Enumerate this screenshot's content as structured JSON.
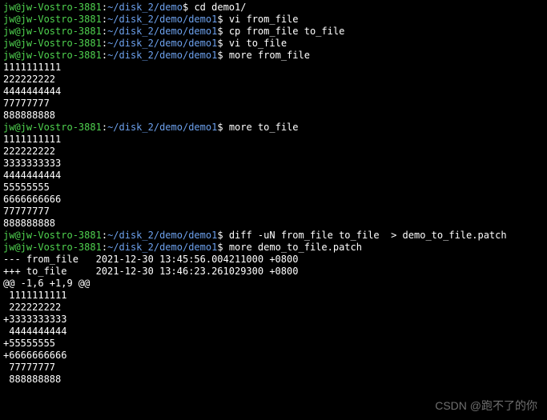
{
  "prompt": {
    "userhost": "jw@jw-Vostro-3881",
    "path_short": "~/disk_2/demo",
    "path_long": "~/disk_2/demo/demo1",
    "sep_colon": ":",
    "dollar": "$"
  },
  "cmds": {
    "cd": "cd demo1/",
    "vi_from": "vi from_file",
    "cp": "cp from_file to_file",
    "vi_to": "vi to_file",
    "more_from": "more from_file",
    "more_to": "more to_file",
    "diff": "diff -uN from_file to_file  > demo_to_file.patch",
    "more_patch": "more demo_to_file.patch"
  },
  "from_file": [
    "1111111111",
    "222222222",
    "4444444444",
    "77777777",
    "888888888"
  ],
  "blank": "",
  "to_file": [
    "1111111111",
    "222222222",
    "3333333333",
    "4444444444",
    "55555555",
    "6666666666",
    "77777777",
    "888888888"
  ],
  "patch": {
    "header_from": "--- from_file   2021-12-30 13:45:56.004211000 +0800",
    "header_to": "+++ to_file     2021-12-30 13:46:23.261029300 +0800",
    "hunk": "@@ -1,6 +1,9 @@",
    "lines": [
      " 1111111111",
      " 222222222",
      "+3333333333",
      " 4444444444",
      "+55555555",
      "+6666666666",
      " 77777777",
      " 888888888"
    ]
  },
  "watermark": "CSDN @跑不了的你"
}
